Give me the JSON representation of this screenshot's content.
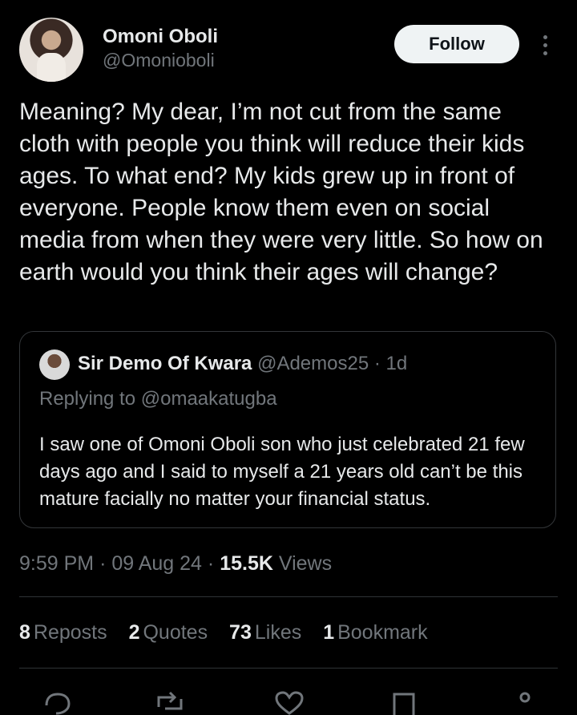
{
  "author": {
    "display_name": "Omoni Oboli",
    "handle": "@Omonioboli"
  },
  "follow_label": "Follow",
  "tweet_text": "Meaning? My dear, I’m not cut from the same cloth with people you think will reduce their kids ages. To what end? My kids grew up in front of everyone. People know them even on social media from when they were very little. So how on earth would you think their ages will change?",
  "quoted": {
    "display_name": "Sir Demo Of Kwara",
    "handle": "@Ademos25",
    "separator": "·",
    "age": "1d",
    "replying_to": "Replying to @omaakatugba",
    "text": "I saw one of Omoni Oboli son who just celebrated 21 few days ago and I said to myself a 21 years old can’t be this mature facially no matter your financial status."
  },
  "timestamp": {
    "time": "9:59 PM",
    "date": "09 Aug 24",
    "views_count": "15.5K",
    "views_label": "Views",
    "separator": "·"
  },
  "stats": {
    "reposts_count": "8",
    "reposts_label": "Reposts",
    "quotes_count": "2",
    "quotes_label": "Quotes",
    "likes_count": "73",
    "likes_label": "Likes",
    "bookmarks_count": "1",
    "bookmarks_label": "Bookmark"
  },
  "action_icons": [
    "reply-icon",
    "repost-icon",
    "like-icon",
    "bookmark-icon",
    "share-icon"
  ]
}
